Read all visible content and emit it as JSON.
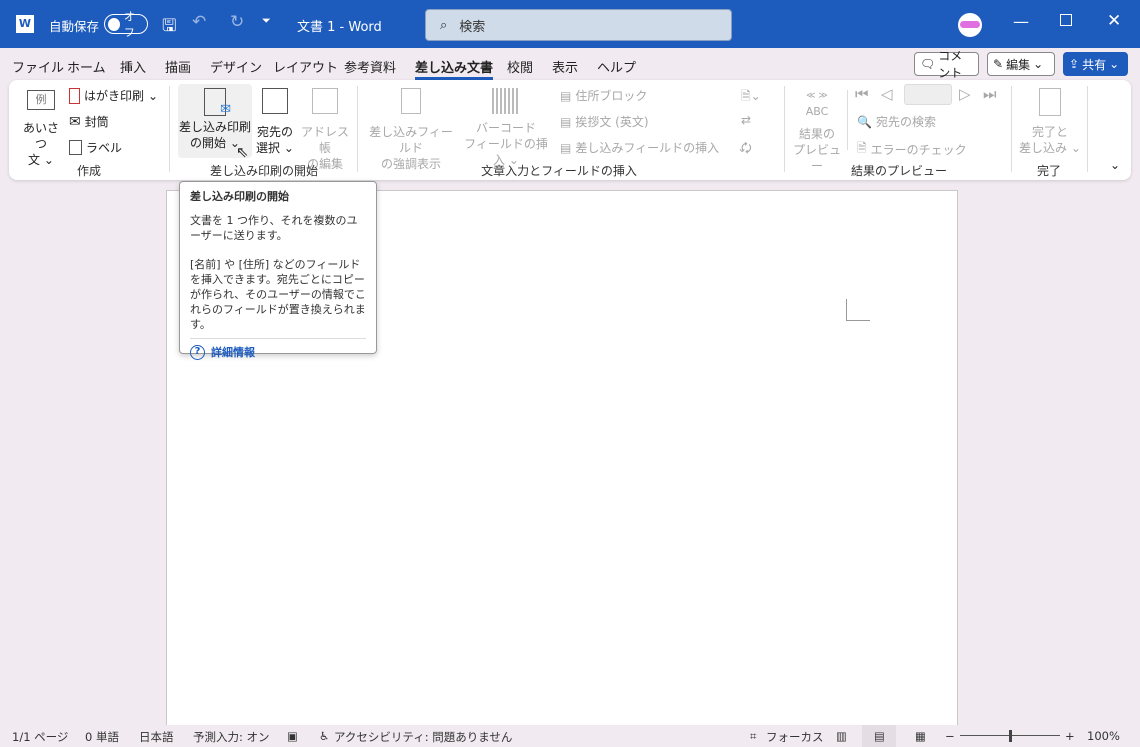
{
  "titlebar": {
    "autosave_label": "自動保存",
    "autosave_state": "オフ",
    "doc_title": "文書 1  -  Word",
    "search_placeholder": "検索"
  },
  "tabs": [
    "ファイル",
    "ホーム",
    "挿入",
    "描画",
    "デザイン",
    "レイアウト",
    "参考資料",
    "差し込み文書",
    "校閲",
    "表示",
    "ヘルプ"
  ],
  "active_tab": "差し込み文書",
  "header_buttons": {
    "comment": "コメント",
    "edit": "編集",
    "share": "共有"
  },
  "ribbon": {
    "create": {
      "label": "作成",
      "greeting_icon": "例",
      "greeting": [
        "あいさつ",
        "文"
      ],
      "postcard": "はがき印刷",
      "envelope": "封筒",
      "label_btn": "ラベル"
    },
    "start": {
      "label": "差し込み印刷の開始",
      "start_btn": [
        "差し込み印刷",
        "の開始"
      ],
      "select": [
        "宛先の",
        "選択"
      ],
      "edit_list": [
        "アドレス帳",
        "の編集"
      ]
    },
    "fields": {
      "label": "文章入力とフィールドの挿入",
      "highlight": [
        "差し込みフィールド",
        "の強調表示"
      ],
      "barcode": [
        "バーコード",
        "フィールドの挿入"
      ],
      "address_block": "住所ブロック",
      "greeting_line": "挨拶文 (英文)",
      "insert_field": "差し込みフィールドの挿入"
    },
    "preview": {
      "label": "結果のプレビュー",
      "abc": "ABC",
      "preview_btn": [
        "結果の",
        "プレビュー"
      ],
      "find": "宛先の検索",
      "check": "エラーのチェック"
    },
    "finish": {
      "label": "完了",
      "finish_btn": [
        "完了と",
        "差し込み"
      ]
    }
  },
  "tooltip": {
    "title": "差し込み印刷の開始",
    "p1": "文書を 1 つ作り、それを複数のユーザーに送ります。",
    "p2": "[名前] や [住所] などのフィールドを挿入できます。宛先ごとにコピーが作られ、そのユーザーの情報でこれらのフィールドが置き換えられます。",
    "link": "詳細情報"
  },
  "status": {
    "page": "1/1 ページ",
    "words": "0 単語",
    "lang": "日本語",
    "predict": "予測入力: オン",
    "accessibility": "アクセシビリティ: 問題ありません",
    "focus": "フォーカス",
    "zoom": "100%"
  },
  "colors": {
    "accent": "#1d5bbd"
  }
}
